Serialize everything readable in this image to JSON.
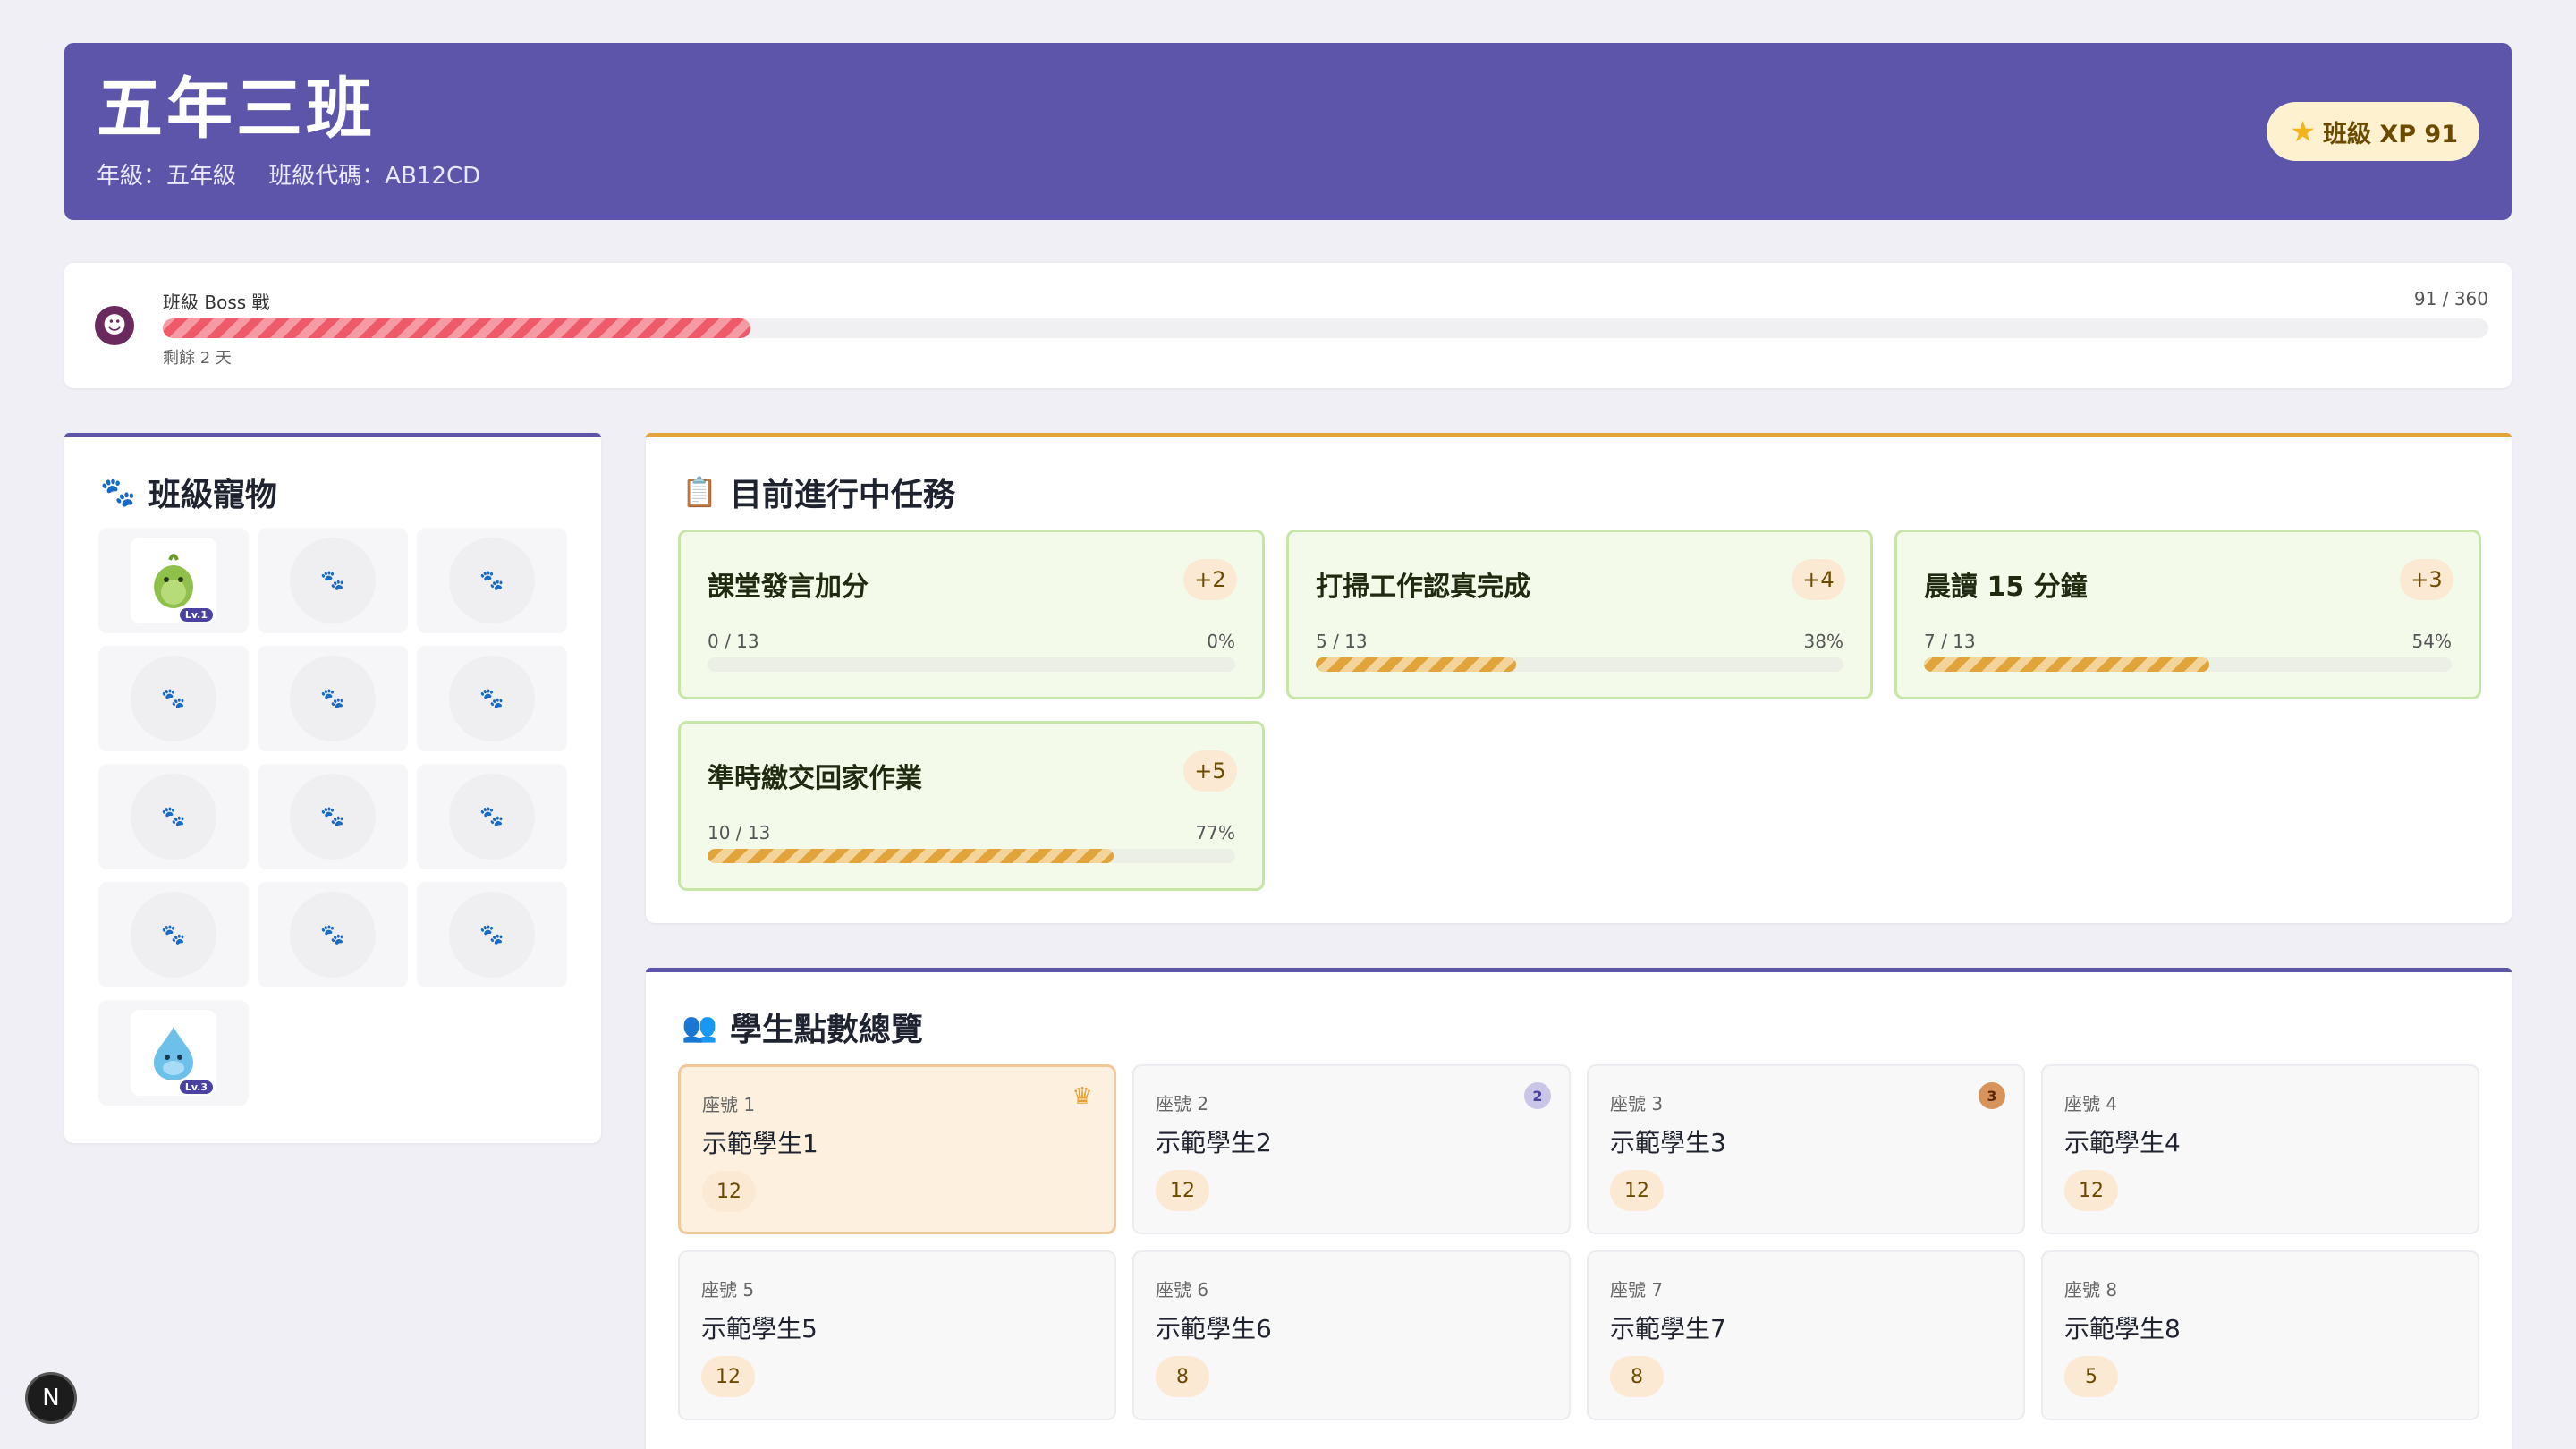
{
  "header": {
    "title": "五年三班",
    "grade": "年級：五年級",
    "class_code": "班級代碼：AB12CD",
    "xp_label": "班級 XP 91"
  },
  "boss": {
    "label": "班級 Boss 戰",
    "count": "91 / 360",
    "current": 91,
    "max": 360,
    "remaining": "剩餘 2 天",
    "icon": "demon-face-icon"
  },
  "pets_panel": {
    "title": "班級寵物",
    "icon": "paw-icon",
    "slots": [
      {
        "type": "pet",
        "pet": "green-blob",
        "level": "Lv.1"
      },
      {
        "type": "empty"
      },
      {
        "type": "empty"
      },
      {
        "type": "empty"
      },
      {
        "type": "empty"
      },
      {
        "type": "empty"
      },
      {
        "type": "empty"
      },
      {
        "type": "empty"
      },
      {
        "type": "empty"
      },
      {
        "type": "empty"
      },
      {
        "type": "empty"
      },
      {
        "type": "empty"
      },
      {
        "type": "pet",
        "pet": "blue-droplet",
        "level": "Lv.3"
      }
    ]
  },
  "quests_panel": {
    "title": "目前進行中任務",
    "icon": "clipboard-icon",
    "quests": [
      {
        "name": "課堂發言加分",
        "points": "+2",
        "progress": "0 / 13",
        "percent_label": "0%",
        "fraction": 0.0
      },
      {
        "name": "打掃工作認真完成",
        "points": "+4",
        "progress": "5 / 13",
        "percent_label": "38%",
        "fraction": 0.38
      },
      {
        "name": "晨讀 15 分鐘",
        "points": "+3",
        "progress": "7 / 13",
        "percent_label": "54%",
        "fraction": 0.54
      },
      {
        "name": "準時繳交回家作業",
        "points": "+5",
        "progress": "10 / 13",
        "percent_label": "77%",
        "fraction": 0.77
      }
    ]
  },
  "students_panel": {
    "title": "學生點數總覽",
    "icon": "users-icon",
    "students": [
      {
        "seat": "座號 1",
        "name": "示範學生1",
        "points": "12",
        "badge": "crown"
      },
      {
        "seat": "座號 2",
        "name": "示範學生2",
        "points": "12",
        "badge": "silver-medal"
      },
      {
        "seat": "座號 3",
        "name": "示範學生3",
        "points": "12",
        "badge": "bronze-medal"
      },
      {
        "seat": "座號 4",
        "name": "示範學生4",
        "points": "12",
        "badge": ""
      },
      {
        "seat": "座號 5",
        "name": "示範學生5",
        "points": "12",
        "badge": ""
      },
      {
        "seat": "座號 6",
        "name": "示範學生6",
        "points": "8",
        "badge": ""
      },
      {
        "seat": "座號 7",
        "name": "示範學生7",
        "points": "8",
        "badge": ""
      },
      {
        "seat": "座號 8",
        "name": "示範學生8",
        "points": "5",
        "badge": ""
      }
    ]
  },
  "colors": {
    "brand": "#5d55a9",
    "quest_accent": "#e0a43a",
    "boss_bar": "#ef5a6a",
    "points_bg": "#fbe9d3"
  },
  "fab": {
    "label": "N"
  }
}
